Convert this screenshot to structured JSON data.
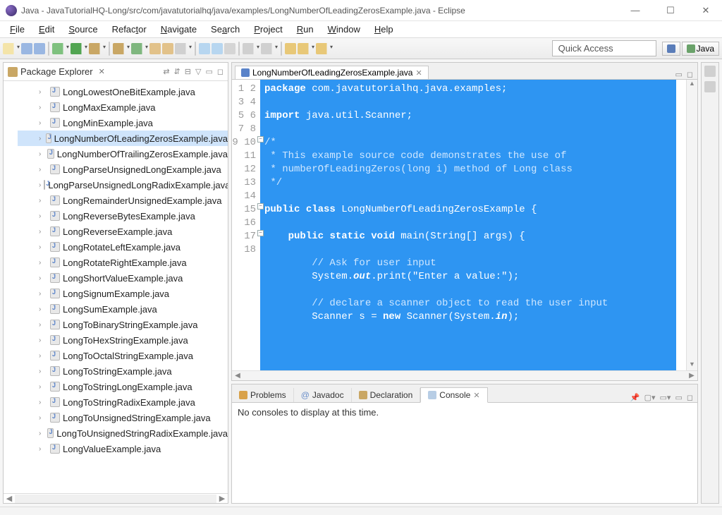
{
  "window": {
    "title": "Java - JavaTutorialHQ-Long/src/com/javatutorialhq/java/examples/LongNumberOfLeadingZerosExample.java - Eclipse"
  },
  "menu": {
    "file": "File",
    "edit": "Edit",
    "source": "Source",
    "refactor": "Refactor",
    "navigate": "Navigate",
    "search": "Search",
    "project": "Project",
    "run": "Run",
    "window": "Window",
    "help": "Help"
  },
  "toolbar": {
    "quick_access": "Quick Access",
    "perspective_java": "Java"
  },
  "package_explorer": {
    "title": "Package Explorer",
    "items": [
      "LongLowestOneBitExample.java",
      "LongMaxExample.java",
      "LongMinExample.java",
      "LongNumberOfLeadingZerosExample.java",
      "LongNumberOfTrailingZerosExample.java",
      "LongParseUnsignedLongExample.java",
      "LongParseUnsignedLongRadixExample.java",
      "LongRemainderUnsignedExample.java",
      "LongReverseBytesExample.java",
      "LongReverseExample.java",
      "LongRotateLeftExample.java",
      "LongRotateRightExample.java",
      "LongShortValueExample.java",
      "LongSignumExample.java",
      "LongSumExample.java",
      "LongToBinaryStringExample.java",
      "LongToHexStringExample.java",
      "LongToOctalStringExample.java",
      "LongToStringExample.java",
      "LongToStringLongExample.java",
      "LongToStringRadixExample.java",
      "LongToUnsignedStringExample.java",
      "LongToUnsignedStringRadixExample.java",
      "LongValueExample.java"
    ],
    "selected_index": 3
  },
  "editor": {
    "tab_label": "LongNumberOfLeadingZerosExample.java",
    "line_numbers": [
      "1",
      "2",
      "3",
      "4",
      "5",
      "6",
      "7",
      "8",
      "9",
      "10",
      "11",
      "12",
      "13",
      "14",
      "15",
      "16",
      "17",
      "18"
    ],
    "code": {
      "l1_k": "package",
      "l1_t": " com.javatutorialhq.java.examples;",
      "l3_k": "import",
      "l3_t": " java.util.Scanner;",
      "l5": "/*",
      "l6": " * This example source code demonstrates the use of",
      "l7": " * numberOfLeadingZeros(long i) method of Long class",
      "l8": " */",
      "l10_k1": "public",
      "l10_k2": "class",
      "l10_t": " LongNumberOfLeadingZerosExample {",
      "l12_k1": "public",
      "l12_k2": "static",
      "l12_k3": "void",
      "l12_t": " main(String[] args) {",
      "l14": "        // Ask for user input",
      "l15a": "        System.",
      "l15b": "out",
      "l15c": ".print(\"Enter a value:\");",
      "l17": "        // declare a scanner object to read the user input",
      "l18a": "        Scanner s = ",
      "l18b": "new",
      "l18c": " Scanner(System.",
      "l18d": "in",
      "l18e": ");"
    }
  },
  "bottom": {
    "tab_problems": "Problems",
    "tab_javadoc": "Javadoc",
    "tab_declaration": "Declaration",
    "tab_console": "Console",
    "console_empty": "No consoles to display at this time."
  }
}
